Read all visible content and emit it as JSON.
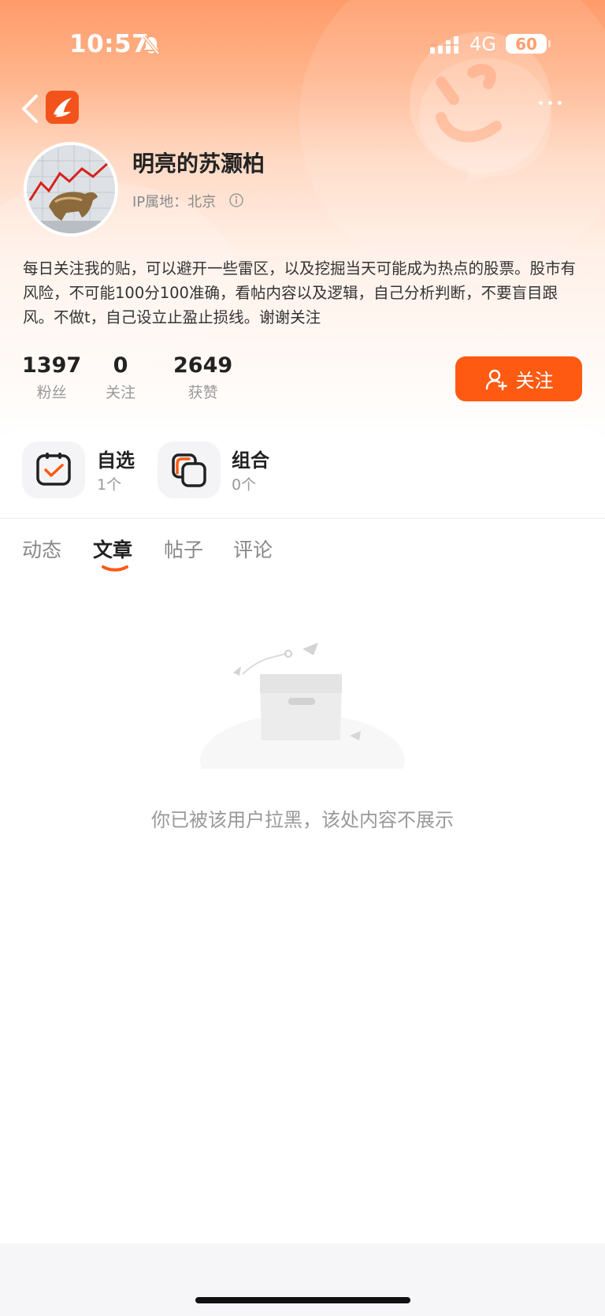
{
  "status_bar": {
    "time": "10:57",
    "network": "4G",
    "battery": "60"
  },
  "header": {
    "back_icon": "chevron-left-icon",
    "app_logo": "app-logo-icon",
    "more_icon": "more-dots-icon"
  },
  "profile": {
    "name": "明亮的苏灏柏",
    "ip_location": "IP属地：北京",
    "bio": "每日关注我的贴，可以避开一些雷区，以及挖掘当天可能成为热点的股票。股市有风险，不可能100分100准确，看帖内容以及逻辑，自己分析判断，不要盲目跟风。不做t，自己设立止盈止损线。谢谢关注",
    "stats": [
      {
        "value": "1397",
        "label": "粉丝"
      },
      {
        "value": "0",
        "label": "关注"
      },
      {
        "value": "2649",
        "label": "获赞"
      }
    ],
    "follow_button": "关注",
    "accent_color": "#ff5a12"
  },
  "collections": [
    {
      "title": "自选",
      "count": "1个",
      "icon": "watchlist-check-icon"
    },
    {
      "title": "组合",
      "count": "0个",
      "icon": "portfolio-icon"
    }
  ],
  "tabs": [
    {
      "label": "动态",
      "active": false
    },
    {
      "label": "文章",
      "active": true
    },
    {
      "label": "帖子",
      "active": false
    },
    {
      "label": "评论",
      "active": false
    }
  ],
  "empty_state": {
    "message": "你已被该用户拉黑，该处内容不展示",
    "icon": "empty-box-icon"
  }
}
